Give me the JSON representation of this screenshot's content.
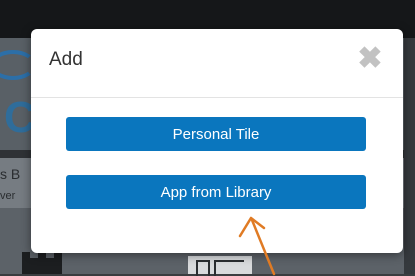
{
  "background": {
    "strip_text_line1": "s B",
    "strip_text_line2": "ver",
    "big_letter": "C"
  },
  "modal": {
    "title": "Add",
    "close_glyph": "✖",
    "buttons": {
      "personal_tile": "Personal Tile",
      "app_from_library": "App from Library"
    }
  },
  "colors": {
    "button": "#0a76be",
    "annotation_arrow": "#e07b24"
  },
  "icons": {
    "close": "close-icon",
    "annotation": "arrow-up-annotation-icon"
  }
}
